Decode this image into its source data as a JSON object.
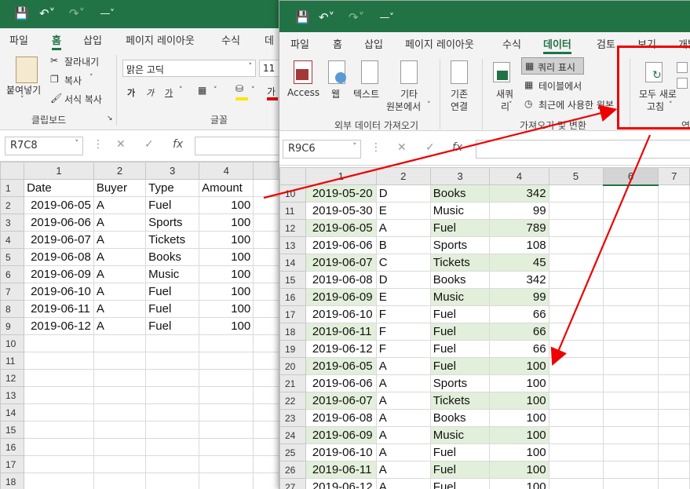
{
  "window1": {
    "menu": [
      "파일",
      "홈",
      "삽입",
      "페이지 레이아웃",
      "수식",
      "데"
    ],
    "active_menu_index": 1,
    "clipboard": {
      "paste": "붙여넣기",
      "cut": "잘라내기",
      "copy": "복사",
      "format_painter": "서식 복사",
      "group_label": "클립보드"
    },
    "font": {
      "name": "맑은 고딕",
      "size": "11",
      "bold": "가",
      "italic": "가",
      "underline": "가",
      "color_label": "가",
      "group_label": "글꼴"
    },
    "name_box": "R7C8",
    "fx": "fx",
    "columns": [
      "1",
      "2",
      "3",
      "4"
    ],
    "rows": [
      {
        "n": "1",
        "date": "Date",
        "buyer": "Buyer",
        "type": "Type",
        "amount": "Amount"
      },
      {
        "n": "2",
        "date": "2019-06-05",
        "buyer": "A",
        "type": "Fuel",
        "amount": "100"
      },
      {
        "n": "3",
        "date": "2019-06-06",
        "buyer": "A",
        "type": "Sports",
        "amount": "100"
      },
      {
        "n": "4",
        "date": "2019-06-07",
        "buyer": "A",
        "type": "Tickets",
        "amount": "100"
      },
      {
        "n": "5",
        "date": "2019-06-08",
        "buyer": "A",
        "type": "Books",
        "amount": "100"
      },
      {
        "n": "6",
        "date": "2019-06-09",
        "buyer": "A",
        "type": "Music",
        "amount": "100"
      },
      {
        "n": "7",
        "date": "2019-06-10",
        "buyer": "A",
        "type": "Fuel",
        "amount": "100"
      },
      {
        "n": "8",
        "date": "2019-06-11",
        "buyer": "A",
        "type": "Fuel",
        "amount": "100"
      },
      {
        "n": "9",
        "date": "2019-06-12",
        "buyer": "A",
        "type": "Fuel",
        "amount": "100"
      },
      {
        "n": "10",
        "date": "",
        "buyer": "",
        "type": "",
        "amount": ""
      },
      {
        "n": "11",
        "date": "",
        "buyer": "",
        "type": "",
        "amount": ""
      },
      {
        "n": "12",
        "date": "",
        "buyer": "",
        "type": "",
        "amount": ""
      },
      {
        "n": "13",
        "date": "",
        "buyer": "",
        "type": "",
        "amount": ""
      },
      {
        "n": "14",
        "date": "",
        "buyer": "",
        "type": "",
        "amount": ""
      },
      {
        "n": "15",
        "date": "",
        "buyer": "",
        "type": "",
        "amount": ""
      },
      {
        "n": "16",
        "date": "",
        "buyer": "",
        "type": "",
        "amount": ""
      },
      {
        "n": "17",
        "date": "",
        "buyer": "",
        "type": "",
        "amount": ""
      },
      {
        "n": "18",
        "date": "",
        "buyer": "",
        "type": "",
        "amount": ""
      }
    ]
  },
  "window2": {
    "menu": [
      "파일",
      "홈",
      "삽입",
      "페이지 레이아웃",
      "수식",
      "데이터",
      "검토",
      "보기",
      "개발"
    ],
    "active_menu_index": 5,
    "external_data": {
      "access": "Access",
      "web": "웹",
      "text": "텍스트",
      "other_line1": "기타",
      "other_line2": "원본에서",
      "existing_line1": "기존",
      "existing_line2": "연결",
      "group_label": "외부 데이터 가져오기"
    },
    "get_transform": {
      "new_line1": "새쿼",
      "new_line2": "리",
      "show_queries": "쿼리 표시",
      "from_table": "테이블에서",
      "recent_sources": "최근에 사용한 원본",
      "group_label": "가져오기 및 변환"
    },
    "connections": {
      "refresh_line1": "모두 새로",
      "refresh_line2": "고침",
      "group_label": "연"
    },
    "name_box": "R9C6",
    "fx": "fx",
    "columns": [
      "1",
      "2",
      "3",
      "4",
      "5",
      "6",
      "7"
    ],
    "rows": [
      {
        "n": "10",
        "date": "2019-05-20",
        "buyer": "D",
        "type": "Books",
        "amount": "342"
      },
      {
        "n": "11",
        "date": "2019-05-30",
        "buyer": "E",
        "type": "Music",
        "amount": "99"
      },
      {
        "n": "12",
        "date": "2019-06-05",
        "buyer": "A",
        "type": "Fuel",
        "amount": "789"
      },
      {
        "n": "13",
        "date": "2019-06-06",
        "buyer": "B",
        "type": "Sports",
        "amount": "108"
      },
      {
        "n": "14",
        "date": "2019-06-07",
        "buyer": "C",
        "type": "Tickets",
        "amount": "45"
      },
      {
        "n": "15",
        "date": "2019-06-08",
        "buyer": "D",
        "type": "Books",
        "amount": "342"
      },
      {
        "n": "16",
        "date": "2019-06-09",
        "buyer": "E",
        "type": "Music",
        "amount": "99"
      },
      {
        "n": "17",
        "date": "2019-06-10",
        "buyer": "F",
        "type": "Fuel",
        "amount": "66"
      },
      {
        "n": "18",
        "date": "2019-06-11",
        "buyer": "F",
        "type": "Fuel",
        "amount": "66"
      },
      {
        "n": "19",
        "date": "2019-06-12",
        "buyer": "F",
        "type": "Fuel",
        "amount": "66"
      },
      {
        "n": "20",
        "date": "2019-06-05",
        "buyer": "A",
        "type": "Fuel",
        "amount": "100"
      },
      {
        "n": "21",
        "date": "2019-06-06",
        "buyer": "A",
        "type": "Sports",
        "amount": "100"
      },
      {
        "n": "22",
        "date": "2019-06-07",
        "buyer": "A",
        "type": "Tickets",
        "amount": "100"
      },
      {
        "n": "23",
        "date": "2019-06-08",
        "buyer": "A",
        "type": "Books",
        "amount": "100"
      },
      {
        "n": "24",
        "date": "2019-06-09",
        "buyer": "A",
        "type": "Music",
        "amount": "100"
      },
      {
        "n": "25",
        "date": "2019-06-10",
        "buyer": "A",
        "type": "Fuel",
        "amount": "100"
      },
      {
        "n": "26",
        "date": "2019-06-11",
        "buyer": "A",
        "type": "Fuel",
        "amount": "100"
      },
      {
        "n": "27",
        "date": "2019-06-12",
        "buyer": "A",
        "type": "Fuel",
        "amount": "100"
      }
    ]
  },
  "colors": {
    "excel_green": "#217346",
    "band": "#e2efda",
    "annotation": "#ee0000"
  }
}
